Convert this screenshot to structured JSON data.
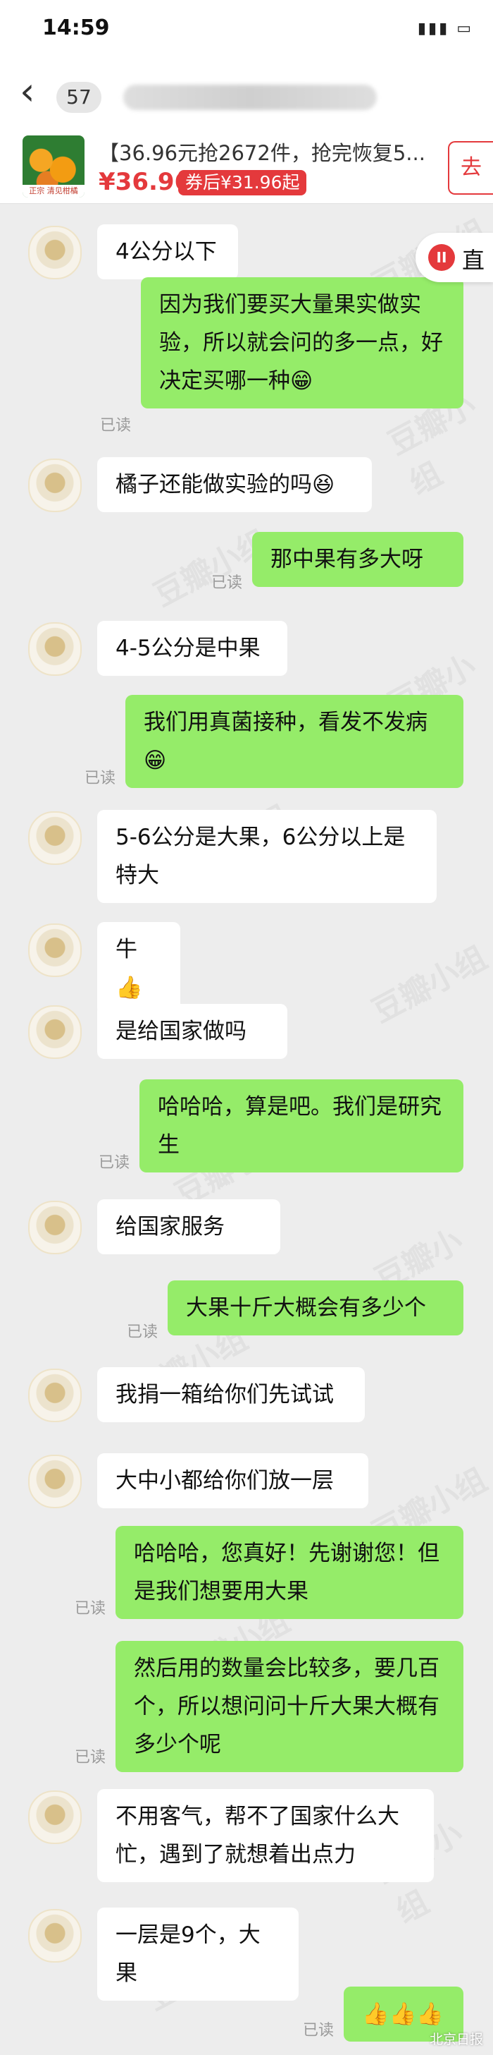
{
  "status": {
    "time": "14:59"
  },
  "header": {
    "unread_count": "57"
  },
  "product": {
    "title": "【36.96元抢2672件，抢完恢复5...",
    "price": "¥36.96",
    "coupon": "券后¥31.96起",
    "thumb_tag": "正宗 清见柑橘",
    "go_label": "去",
    "live_label": "直"
  },
  "read_label": "已读",
  "watermark_text": "豆瓣小组",
  "footer_mark": "北京日报",
  "messages": [
    {
      "from": "seller",
      "text": "4公分以下"
    },
    {
      "from": "me",
      "text": "因为我们要买大量果实做实验，所以就会问的多一点，好决定买哪一种😁",
      "read": "已读"
    },
    {
      "from": "seller",
      "text": "橘子还能做实验的吗😆"
    },
    {
      "from": "me",
      "text": "那中果有多大呀",
      "read": "已读"
    },
    {
      "from": "seller",
      "text": "4-5公分是中果"
    },
    {
      "from": "me",
      "text": "我们用真菌接种，看发不发病😁",
      "read": "已读"
    },
    {
      "from": "seller",
      "text": "5-6公分是大果，6公分以上是特大"
    },
    {
      "from": "seller",
      "text": "牛👍"
    },
    {
      "from": "seller",
      "text": "是给国家做吗"
    },
    {
      "from": "me",
      "text": "哈哈哈，算是吧。我们是研究生",
      "read": "已读"
    },
    {
      "from": "seller",
      "text": "给国家服务"
    },
    {
      "from": "me",
      "text": "大果十斤大概会有多少个",
      "read": "已读"
    },
    {
      "from": "seller",
      "text": "我捐一箱给你们先试试"
    },
    {
      "from": "seller",
      "text": "大中小都给你们放一层"
    },
    {
      "from": "me",
      "text": "哈哈哈，您真好！先谢谢您！但是我们想要用大果",
      "read": "已读"
    },
    {
      "from": "me",
      "text": "然后用的数量会比较多，要几百个，所以想问问十斤大果大概有多少个呢",
      "read": "已读"
    },
    {
      "from": "seller",
      "text": "不用客气，帮不了国家什么大忙，遇到了就想着出点力"
    },
    {
      "from": "seller",
      "text": "一层是9个，大果"
    },
    {
      "from": "me",
      "text": "👍👍👍",
      "read": "已读"
    }
  ]
}
